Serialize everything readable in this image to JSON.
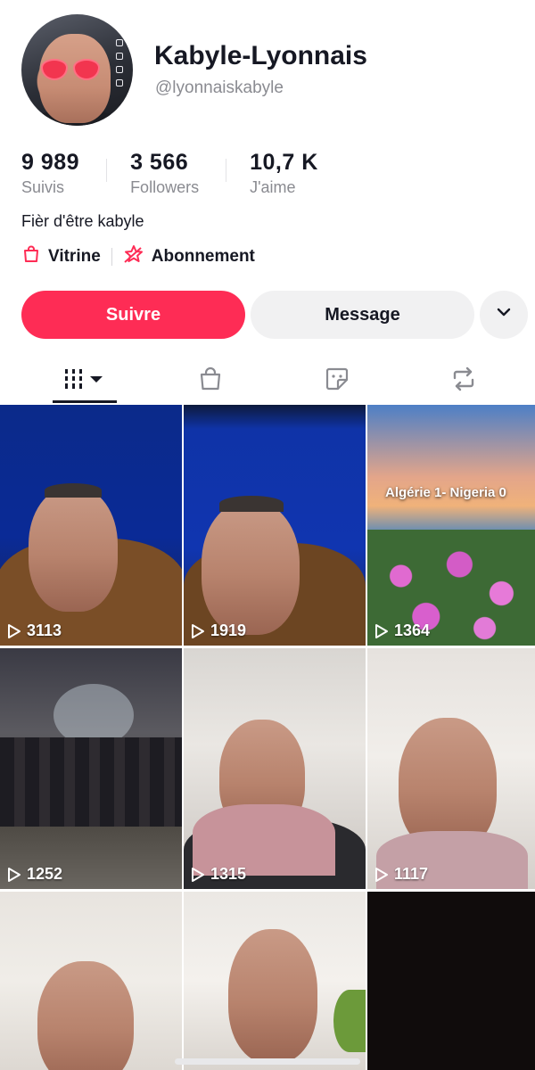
{
  "profile": {
    "display_name": "Kabyle-Lyonnais",
    "handle": "@lyonnaiskabyle",
    "bio": "Fièr d'être kabyle"
  },
  "stats": [
    {
      "value": "9 989",
      "label": "Suivis"
    },
    {
      "value": "3 566",
      "label": "Followers"
    },
    {
      "value": "10,7 K",
      "label": "J'aime"
    }
  ],
  "links": {
    "showcase": "Vitrine",
    "subscription": "Abonnement"
  },
  "buttons": {
    "follow": "Suivre",
    "message": "Message"
  },
  "tabs": [
    {
      "icon": "grid-icon",
      "active": true
    },
    {
      "icon": "shopping-bag-icon",
      "active": false
    },
    {
      "icon": "sticker-icon",
      "active": false
    },
    {
      "icon": "repost-icon",
      "active": false
    }
  ],
  "videos": [
    {
      "views": "3113"
    },
    {
      "views": "1919"
    },
    {
      "views": "1364",
      "overlay_text": "Algérie 1- Nigeria 0"
    },
    {
      "views": "1252"
    },
    {
      "views": "1315"
    },
    {
      "views": "1117"
    },
    {
      "views": ""
    },
    {
      "views": ""
    },
    {
      "views": ""
    }
  ],
  "colors": {
    "accent": "#fe2c55",
    "text": "#161823",
    "secondary_text": "#8a8b91",
    "button_gray": "#f1f1f2"
  }
}
